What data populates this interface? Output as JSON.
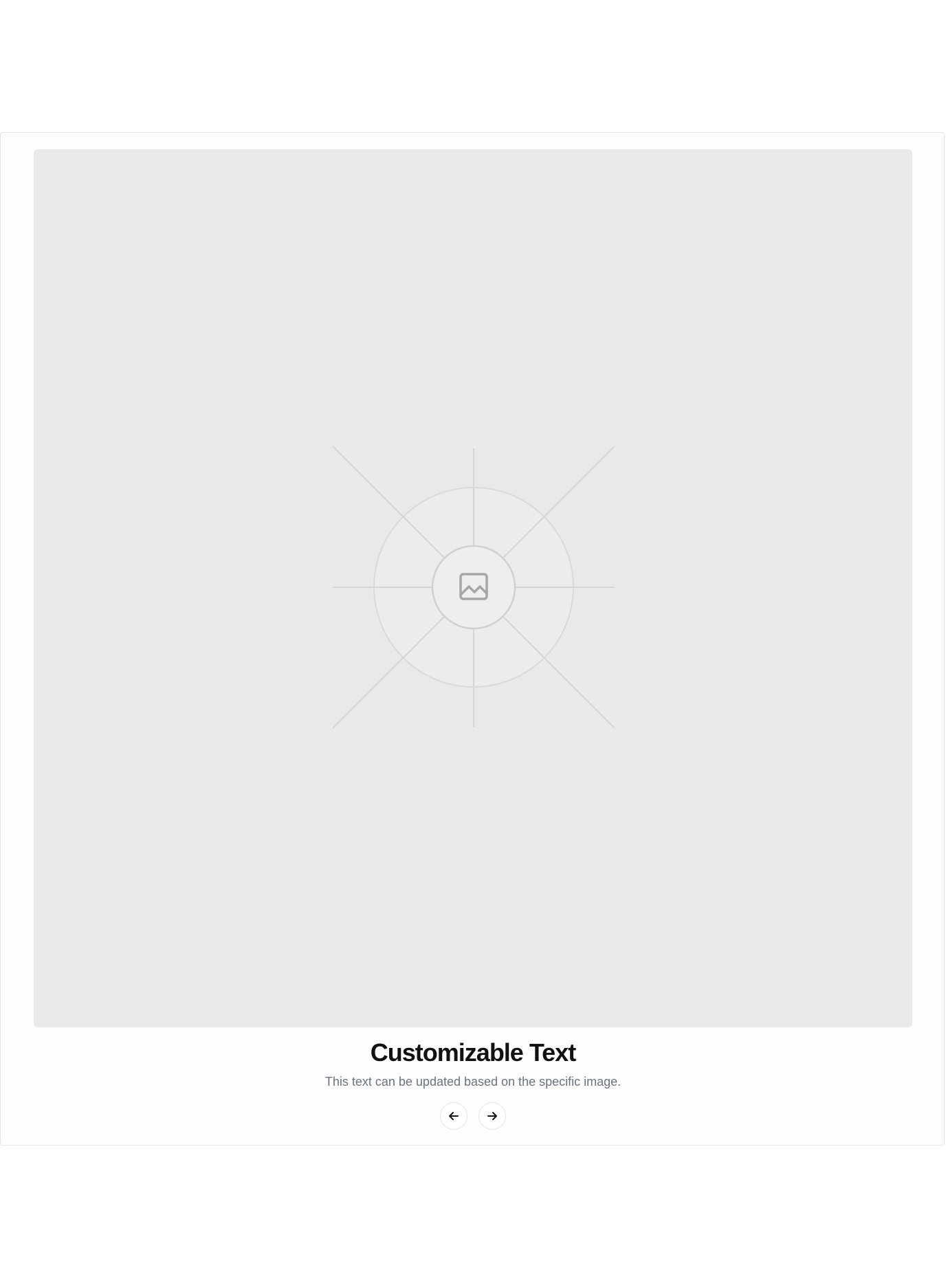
{
  "card": {
    "image": {
      "icon": "image-placeholder-icon"
    },
    "title": "Customizable Text",
    "description": "This text can be updated based on the specific image."
  },
  "navigation": {
    "prev_icon": "arrow-left-icon",
    "next_icon": "arrow-right-icon"
  },
  "colors": {
    "image_background": "#e9e9e9",
    "title": "#111111",
    "description": "#6b7280",
    "card_border": "#e6e6e6"
  }
}
